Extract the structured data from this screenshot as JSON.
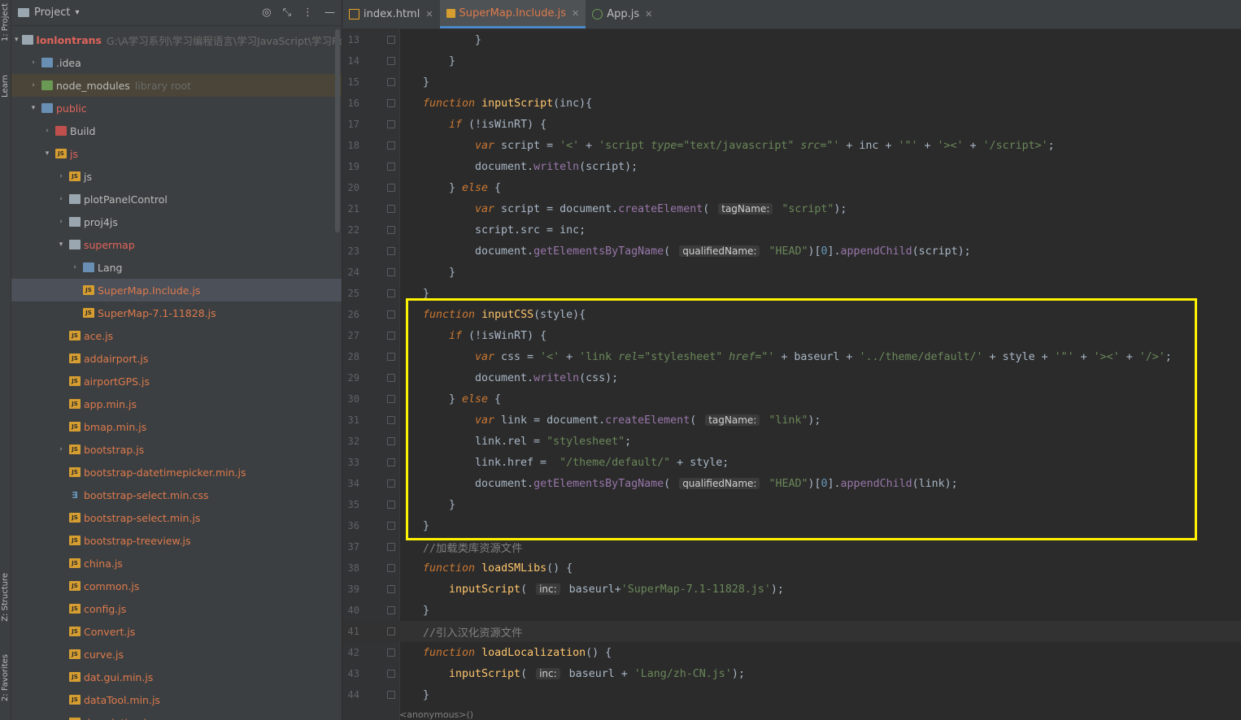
{
  "side_tabs": [
    {
      "label": "1: Project"
    },
    {
      "label": "Learn"
    },
    {
      "label": "Z: Structure"
    },
    {
      "label": "2: Favorites"
    }
  ],
  "project": {
    "title": "Project",
    "rows": [
      {
        "name": "lonlontrans",
        "hint": "G:\\A学习系列\\学习编程语言\\学习JavaScript\\学习React",
        "icon": "folder",
        "arrow": "▾",
        "indent": 0,
        "style": "red-bold"
      },
      {
        "name": ".idea",
        "hint": "",
        "icon": "folder-blue",
        "arrow": "›",
        "indent": 1,
        "style": ""
      },
      {
        "name": "node_modules",
        "hint": "library root",
        "icon": "folder-green",
        "arrow": "›",
        "indent": 1,
        "style": "",
        "row": "nm"
      },
      {
        "name": "public",
        "hint": "",
        "icon": "folder-blue",
        "arrow": "▾",
        "indent": 1,
        "style": "red"
      },
      {
        "name": "Build",
        "hint": "",
        "icon": "folder-red",
        "arrow": "›",
        "indent": 2,
        "style": ""
      },
      {
        "name": "js",
        "hint": "",
        "icon": "js",
        "arrow": "▾",
        "indent": 2,
        "style": "red"
      },
      {
        "name": "js",
        "hint": "",
        "icon": "js",
        "arrow": "›",
        "indent": 3,
        "style": ""
      },
      {
        "name": "plotPanelControl",
        "hint": "",
        "icon": "folder",
        "arrow": "›",
        "indent": 3,
        "style": ""
      },
      {
        "name": "proj4js",
        "hint": "",
        "icon": "folder",
        "arrow": "›",
        "indent": 3,
        "style": ""
      },
      {
        "name": "supermap",
        "hint": "",
        "icon": "folder",
        "arrow": "▾",
        "indent": 3,
        "style": "red"
      },
      {
        "name": "Lang",
        "hint": "",
        "icon": "lang",
        "arrow": "›",
        "indent": 4,
        "style": ""
      },
      {
        "name": "SuperMap.Include.js",
        "hint": "",
        "icon": "js",
        "arrow": "",
        "indent": 4,
        "style": "orange",
        "row": "sel"
      },
      {
        "name": "SuperMap-7.1-11828.js",
        "hint": "",
        "icon": "js",
        "arrow": "",
        "indent": 4,
        "style": "orange"
      },
      {
        "name": "ace.js",
        "hint": "",
        "icon": "js",
        "arrow": "",
        "indent": 3,
        "style": "orange"
      },
      {
        "name": "addairport.js",
        "hint": "",
        "icon": "js",
        "arrow": "",
        "indent": 3,
        "style": "orange"
      },
      {
        "name": "airportGPS.js",
        "hint": "",
        "icon": "js",
        "arrow": "",
        "indent": 3,
        "style": "orange"
      },
      {
        "name": "app.min.js",
        "hint": "",
        "icon": "js",
        "arrow": "",
        "indent": 3,
        "style": "orange"
      },
      {
        "name": "bmap.min.js",
        "hint": "",
        "icon": "js",
        "arrow": "",
        "indent": 3,
        "style": "orange"
      },
      {
        "name": "bootstrap.js",
        "hint": "",
        "icon": "js",
        "arrow": "›",
        "indent": 3,
        "style": "orange"
      },
      {
        "name": "bootstrap-datetimepicker.min.js",
        "hint": "",
        "icon": "js",
        "arrow": "",
        "indent": 3,
        "style": "orange"
      },
      {
        "name": "bootstrap-select.min.css",
        "hint": "",
        "icon": "css",
        "arrow": "",
        "indent": 3,
        "style": "orange"
      },
      {
        "name": "bootstrap-select.min.js",
        "hint": "",
        "icon": "js",
        "arrow": "",
        "indent": 3,
        "style": "orange"
      },
      {
        "name": "bootstrap-treeview.js",
        "hint": "",
        "icon": "js",
        "arrow": "",
        "indent": 3,
        "style": "orange"
      },
      {
        "name": "china.js",
        "hint": "",
        "icon": "js",
        "arrow": "",
        "indent": 3,
        "style": "orange"
      },
      {
        "name": "common.js",
        "hint": "",
        "icon": "js",
        "arrow": "",
        "indent": 3,
        "style": "orange"
      },
      {
        "name": "config.js",
        "hint": "",
        "icon": "js",
        "arrow": "",
        "indent": 3,
        "style": "orange"
      },
      {
        "name": "Convert.js",
        "hint": "",
        "icon": "js",
        "arrow": "",
        "indent": 3,
        "style": "orange"
      },
      {
        "name": "curve.js",
        "hint": "",
        "icon": "js",
        "arrow": "",
        "indent": 3,
        "style": "orange"
      },
      {
        "name": "dat.gui.min.js",
        "hint": "",
        "icon": "js",
        "arrow": "",
        "indent": 3,
        "style": "orange"
      },
      {
        "name": "dataTool.min.js",
        "hint": "",
        "icon": "js",
        "arrow": "",
        "indent": 3,
        "style": "orange"
      },
      {
        "name": "description.js",
        "hint": "",
        "icon": "js",
        "arrow": "",
        "indent": 3,
        "style": "orange"
      }
    ]
  },
  "editor": {
    "tabs": [
      {
        "label": "index.html",
        "icon": "html",
        "active": false
      },
      {
        "label": "SuperMap.Include.js",
        "icon": "js",
        "active": true
      },
      {
        "label": "App.js",
        "icon": "app",
        "active": false
      }
    ],
    "current_line": "41",
    "breadcrumb": "<anonymous>()",
    "lines": [
      {
        "n": "13",
        "indent": 2,
        "html": "}"
      },
      {
        "n": "14",
        "indent": 1,
        "html": "}"
      },
      {
        "n": "15",
        "indent": 0,
        "html": "}"
      },
      {
        "n": "16",
        "indent": 0,
        "html": "<span class='kw'>function</span> <span class='fn'>inputScript</span>(inc){"
      },
      {
        "n": "17",
        "indent": 1,
        "html": "<span class='kw'>if</span> (!isWinRT) {"
      },
      {
        "n": "18",
        "indent": 2,
        "html": "<span class='kw'>var</span> script = <span class='str'>'&lt;'</span> + <span class='str'>'script <i>type</i>=\"text/javascript\" <i>src</i>=\"'</span> + inc + <span class='str'>'\"'</span> + <span class='str'>'&gt;&lt;'</span> + <span class='str'>'/script&gt;'</span>;"
      },
      {
        "n": "19",
        "indent": 2,
        "html": "document.<span class='prop'>writeln</span>(script);"
      },
      {
        "n": "20",
        "indent": 1,
        "html": "} <span class='kw'>else</span> {"
      },
      {
        "n": "21",
        "indent": 2,
        "html": "<span class='kw'>var</span> script = document.<span class='prop'>createElement</span>( <span class='hint-inl'>tagName:</span> <span class='str'>\"script\"</span>);"
      },
      {
        "n": "22",
        "indent": 2,
        "html": "script.src = inc;"
      },
      {
        "n": "23",
        "indent": 2,
        "html": "document.<span class='prop'>getElementsByTagName</span>( <span class='hint-inl'>qualifiedName:</span> <span class='str'>\"HEAD\"</span>)[<span class='num'>0</span>].<span class='prop'>appendChild</span>(script);"
      },
      {
        "n": "24",
        "indent": 1,
        "html": "}"
      },
      {
        "n": "25",
        "indent": 0,
        "html": "}"
      },
      {
        "n": "26",
        "indent": 0,
        "html": "<span class='kw'>function</span> <span class='fn'>inputCSS</span>(style){"
      },
      {
        "n": "27",
        "indent": 1,
        "html": "<span class='kw'>if</span> (!isWinRT) {"
      },
      {
        "n": "28",
        "indent": 2,
        "html": "<span class='kw'>var</span> css = <span class='str'>'&lt;'</span> + <span class='str'>'link <i>rel</i>=\"stylesheet\" <i>href</i>=\"'</span> + baseurl + <span class='str'>'../theme/default/'</span> + style + <span class='str'>'\"'</span> + <span class='str'>'&gt;&lt;'</span> + <span class='str'>'/&gt;'</span>;"
      },
      {
        "n": "29",
        "indent": 2,
        "html": "document.<span class='prop'>writeln</span>(css);"
      },
      {
        "n": "30",
        "indent": 1,
        "html": "} <span class='kw'>else</span> {"
      },
      {
        "n": "31",
        "indent": 2,
        "html": "<span class='kw'>var</span> link = document.<span class='prop'>createElement</span>( <span class='hint-inl'>tagName:</span> <span class='str'>\"link\"</span>);"
      },
      {
        "n": "32",
        "indent": 2,
        "html": "link.rel = <span class='str'>\"stylesheet\"</span>;"
      },
      {
        "n": "33",
        "indent": 2,
        "html": "link.href =  <span class='str'>\"/theme/default/\"</span> + style;"
      },
      {
        "n": "34",
        "indent": 2,
        "html": "document.<span class='prop'>getElementsByTagName</span>( <span class='hint-inl'>qualifiedName:</span> <span class='str'>\"HEAD\"</span>)[<span class='num'>0</span>].<span class='prop'>appendChild</span>(link);"
      },
      {
        "n": "35",
        "indent": 1,
        "html": "}"
      },
      {
        "n": "36",
        "indent": 0,
        "html": "}"
      },
      {
        "n": "37",
        "indent": 0,
        "html": "<span class='cm'>//加载类库资源文件</span>"
      },
      {
        "n": "38",
        "indent": 0,
        "html": "<span class='kw'>function</span> <span class='fn'>loadSMLibs</span>() {"
      },
      {
        "n": "39",
        "indent": 1,
        "html": "<span class='fn'>inputScript</span>( <span class='hint-inl'>inc:</span> baseurl+<span class='str'>'SuperMap-7.1-11828.js'</span>);"
      },
      {
        "n": "40",
        "indent": 0,
        "html": "}"
      },
      {
        "n": "41",
        "indent": 0,
        "html": "<span class='cm'>//引入汉化资源文件</span>"
      },
      {
        "n": "42",
        "indent": 0,
        "html": "<span class='kw'>function</span> <span class='fn'>loadLocalization</span>() {"
      },
      {
        "n": "43",
        "indent": 1,
        "html": "<span class='fn'>inputScript</span>( <span class='hint-inl'>inc:</span> baseurl + <span class='str'>'Lang/zh-CN.js'</span>);"
      },
      {
        "n": "44",
        "indent": 0,
        "html": "}"
      }
    ]
  },
  "colors": {
    "highlight_box": "#fff200",
    "keyword": "#cc7832",
    "function_name": "#ffc66d",
    "string": "#6a8759",
    "comment": "#808080"
  }
}
